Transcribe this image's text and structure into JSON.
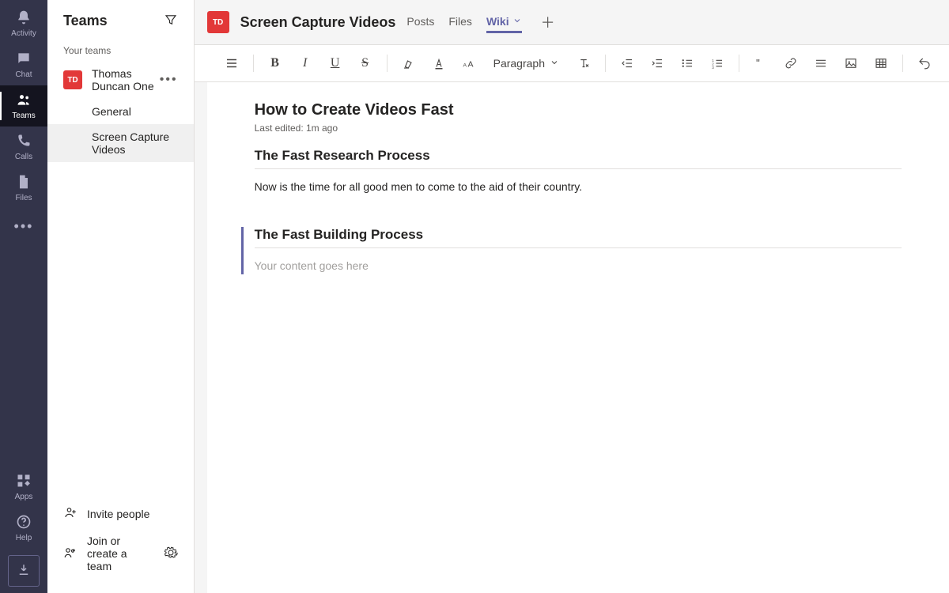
{
  "rail": {
    "items": [
      {
        "label": "Activity"
      },
      {
        "label": "Chat"
      },
      {
        "label": "Teams"
      },
      {
        "label": "Calls"
      },
      {
        "label": "Files"
      }
    ],
    "apps_label": "Apps",
    "help_label": "Help"
  },
  "panel": {
    "title": "Teams",
    "section_label": "Your teams",
    "team": {
      "initials": "TD",
      "name": "Thomas Duncan One",
      "channels": [
        {
          "name": "General"
        },
        {
          "name": "Screen Capture Videos"
        }
      ]
    },
    "invite_label": "Invite people",
    "join_label": "Join or create a team"
  },
  "main": {
    "channel_initials": "TD",
    "channel_title": "Screen Capture Videos",
    "tabs": [
      {
        "label": "Posts"
      },
      {
        "label": "Files"
      },
      {
        "label": "Wiki"
      }
    ],
    "paragraph_label": "Paragraph"
  },
  "wiki": {
    "title": "How to Create Videos Fast",
    "last_edited": "Last edited: 1m ago",
    "sections": [
      {
        "heading": "The Fast Research Process",
        "body": "Now is the time for all good men to come to the aid of their country."
      },
      {
        "heading": "The Fast Building Process",
        "placeholder": "Your content goes here"
      }
    ]
  },
  "colors": {
    "brand": "#6264a7",
    "accent": "#e23838",
    "rail_bg": "#33344a"
  }
}
